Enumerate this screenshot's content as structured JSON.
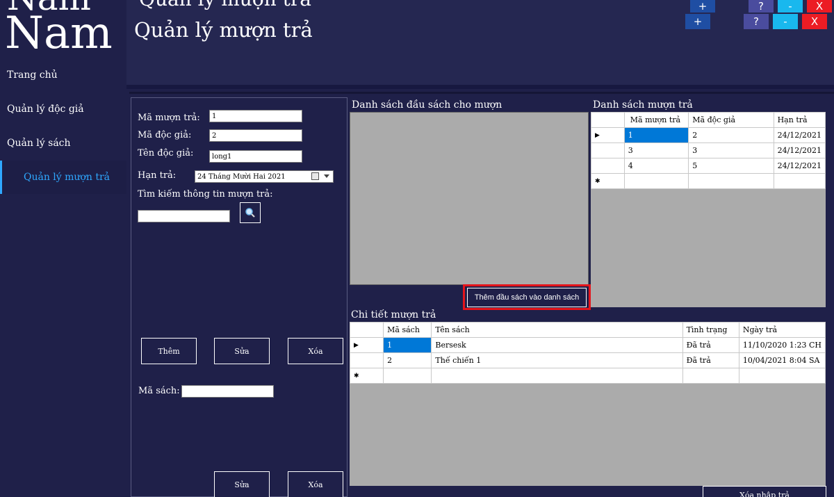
{
  "app": {
    "logo_text": "Nam",
    "title": "Quản lý mượn trả"
  },
  "window_buttons": {
    "plus": "+",
    "help": "?",
    "minimize": "-",
    "close": "X"
  },
  "sidebar": {
    "items": [
      {
        "label": "Trang chủ"
      },
      {
        "label": "Quản lý độc giả"
      },
      {
        "label": "Quản lý sách"
      },
      {
        "label": "Quản lý mượn trả"
      }
    ]
  },
  "form": {
    "ma_muon_tra": {
      "label": "Mã mượn trả:",
      "value": "1"
    },
    "ma_doc_gia": {
      "label": "Mã độc giả:",
      "value": "2"
    },
    "ten_doc_gia": {
      "label": "Tên độc giả:",
      "value": "long1"
    },
    "han_tra": {
      "label": "Hạn trả:",
      "value": "24  Tháng Mười Hai  2021"
    },
    "search": {
      "label": "Tìm kiếm thông tin mượn trả:",
      "value": ""
    },
    "buttons": {
      "them": "Thêm",
      "sua": "Sửa",
      "xoa": "Xóa"
    },
    "ma_sach": {
      "label": "Mã sách:",
      "value": ""
    },
    "bottom_buttons": {
      "sua": "Sửa",
      "xoa": "Xóa"
    }
  },
  "book_list": {
    "title": "Danh sách đầu sách cho mượn",
    "add_button": "Thêm đầu sách vào danh sách"
  },
  "loan_list": {
    "title": "Danh sách mượn trả",
    "columns": [
      "Mã mượn trả",
      "Mã độc giả",
      "Hạn trả"
    ],
    "rows": [
      [
        "1",
        "2",
        "24/12/2021"
      ],
      [
        "3",
        "3",
        "24/12/2021"
      ],
      [
        "4",
        "5",
        "24/12/2021"
      ]
    ]
  },
  "loan_detail": {
    "title": "Chi tiết mượn trả",
    "columns": [
      "Mã sách",
      "Tên sách",
      "Tình trạng",
      "Ngày trả"
    ],
    "rows": [
      [
        "1",
        "Bersesk",
        "Đã trả",
        "11/10/2020 1:23 CH"
      ],
      [
        "2",
        "Thế chiến 1",
        "Đã trả",
        "10/04/2021 8:04 SA"
      ]
    ],
    "bottom_button": "Xóa nhập trả"
  },
  "colors": {
    "background": "#1f2049",
    "header": "#252751",
    "accent": "#2fa8ff",
    "selection": "#0078d7",
    "highlight": "#e4141b"
  },
  "icons": {
    "row_indicator": "triangle-right",
    "new_row": "asterisk",
    "search": "magnifier-icon",
    "calendar": "calendar-icon"
  }
}
